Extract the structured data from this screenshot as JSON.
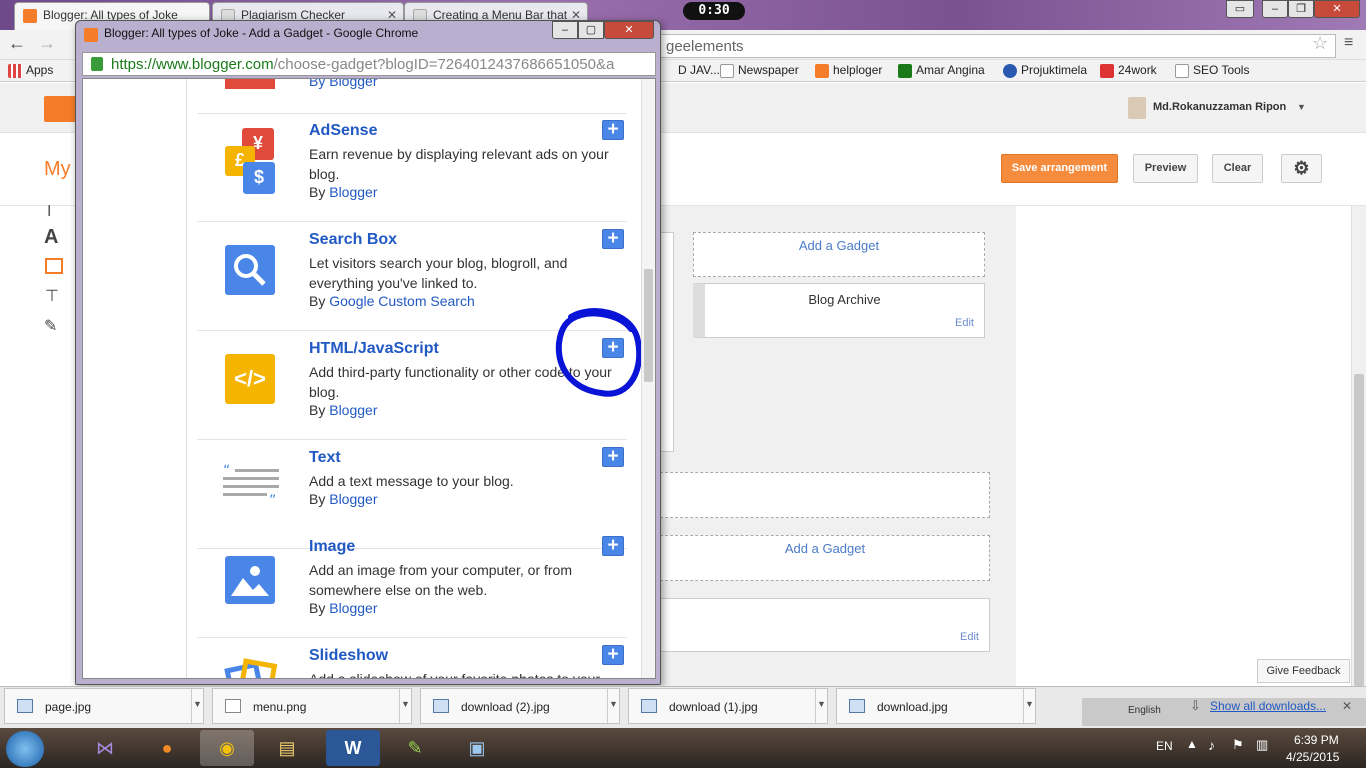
{
  "browser": {
    "tabs": [
      {
        "label": "Blogger: All types of Joke",
        "active": true
      },
      {
        "label": "Plagiarism Checker",
        "active": false
      },
      {
        "label": "Creating a Menu Bar that",
        "active": false
      }
    ],
    "timer": "0:30",
    "url_suffix": "geelements",
    "bookmarks": [
      "Apps",
      "D JAV...",
      "Newspaper",
      "helploger",
      "Amar Angina",
      "Projuktimela",
      "24work",
      "SEO Tools"
    ]
  },
  "blogger": {
    "user": "Md.Rokanuzzaman Ripon",
    "page_title_partial": "My",
    "buttons": {
      "save": "Save arrangement",
      "preview": "Preview",
      "clear": "Clear"
    },
    "accent": "#f57d2a"
  },
  "layout_canvas": {
    "add_gadget": "Add a Gadget",
    "add_gadget_2": "Add a Gadget",
    "blog_archive": "Blog Archive",
    "edit": "Edit",
    "edit_2": "Edit"
  },
  "popup": {
    "title": "Blogger: All types of Joke - Add a Gadget - Google Chrome",
    "url_host": "https://www.blogger.com",
    "url_path": "/choose-gadget?blogID=7264012437686651050&a",
    "top_by": "By Blogger",
    "gadgets": [
      {
        "title": "AdSense",
        "desc": "Earn revenue by displaying relevant ads on your blog.",
        "by": "By",
        "author": "Blogger"
      },
      {
        "title": "Search Box",
        "desc": "Let visitors search your blog, blogroll, and everything you've linked to.",
        "by": "By",
        "author": "Google Custom Search"
      },
      {
        "title": "HTML/JavaScript",
        "desc": "Add third-party functionality or other code to your blog.",
        "by": "By",
        "author": "Blogger"
      },
      {
        "title": "Text",
        "desc": "Add a text message to your blog.",
        "by": "By",
        "author": "Blogger"
      },
      {
        "title": "Image",
        "desc": "Add an image from your computer, or from somewhere else on the web.",
        "by": "By",
        "author": "Blogger"
      },
      {
        "title": "Slideshow",
        "desc": "Add a slideshow of your favorite photos to your",
        "by": "",
        "author": ""
      }
    ],
    "highlight_color": "#0a14d6"
  },
  "feedback": "Give Feedback",
  "downloads": {
    "files": [
      "page.jpg",
      "menu.png",
      "download (2).jpg",
      "download (1).jpg",
      "download.jpg"
    ],
    "language": "English",
    "show_all": "Show all downloads..."
  },
  "taskbar": {
    "lang": "EN",
    "time": "6:39 PM",
    "date": "4/25/2015"
  }
}
